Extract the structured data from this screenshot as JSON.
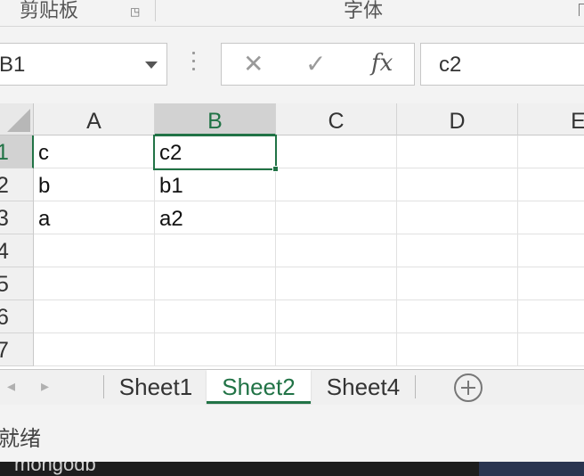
{
  "ribbon": {
    "clipboard_label": "剪贴板",
    "font_label": "字体"
  },
  "formula_bar": {
    "name_box": "B1",
    "formula": "c2",
    "fx_label": "fx",
    "cancel_icon": "close-icon",
    "enter_icon": "check-icon"
  },
  "grid": {
    "columns": [
      "A",
      "B",
      "C",
      "D",
      "E"
    ],
    "rows": [
      "1",
      "2",
      "3",
      "4",
      "5",
      "6",
      "7"
    ],
    "active_column": "B",
    "active_row": "1",
    "cells": [
      [
        "c",
        "c2"
      ],
      [
        "b",
        "b1"
      ],
      [
        "a",
        "a2"
      ]
    ]
  },
  "sheets": {
    "tabs": [
      "Sheet1",
      "Sheet2",
      "Sheet4"
    ],
    "active": "Sheet2"
  },
  "status": {
    "text": "就绪"
  },
  "underlay": {
    "text": "mongodb"
  },
  "colors": {
    "accent": "#217346",
    "header_bg": "#f0f0f0",
    "active_header_bg": "#d2d2d2"
  }
}
